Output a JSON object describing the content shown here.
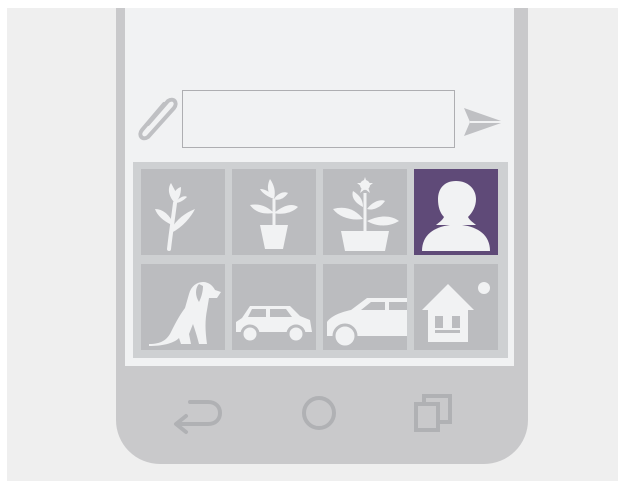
{
  "message_input": {
    "value": "",
    "placeholder": ""
  },
  "symbol_tiles": [
    {
      "name": "flower-symbol",
      "icon": "flower-icon",
      "selected": false
    },
    {
      "name": "potted-plant-symbol",
      "icon": "potted-plant-icon",
      "selected": false
    },
    {
      "name": "planter-symbol",
      "icon": "planter-icon",
      "selected": false
    },
    {
      "name": "person-symbol",
      "icon": "person-icon",
      "selected": true
    },
    {
      "name": "dog-symbol",
      "icon": "dog-icon",
      "selected": false
    },
    {
      "name": "small-car-symbol",
      "icon": "small-car-icon",
      "selected": false
    },
    {
      "name": "car-symbol",
      "icon": "car-icon",
      "selected": false
    },
    {
      "name": "house-symbol",
      "icon": "house-icon",
      "selected": false
    }
  ],
  "nav_bar": [
    "back-icon",
    "home-icon",
    "recent-apps-icon"
  ],
  "colors": {
    "accent": "#5f4a78",
    "tile": "#bbbcbf",
    "phone_body": "#c9c9cb",
    "icon_light": "#f1f2f3"
  }
}
